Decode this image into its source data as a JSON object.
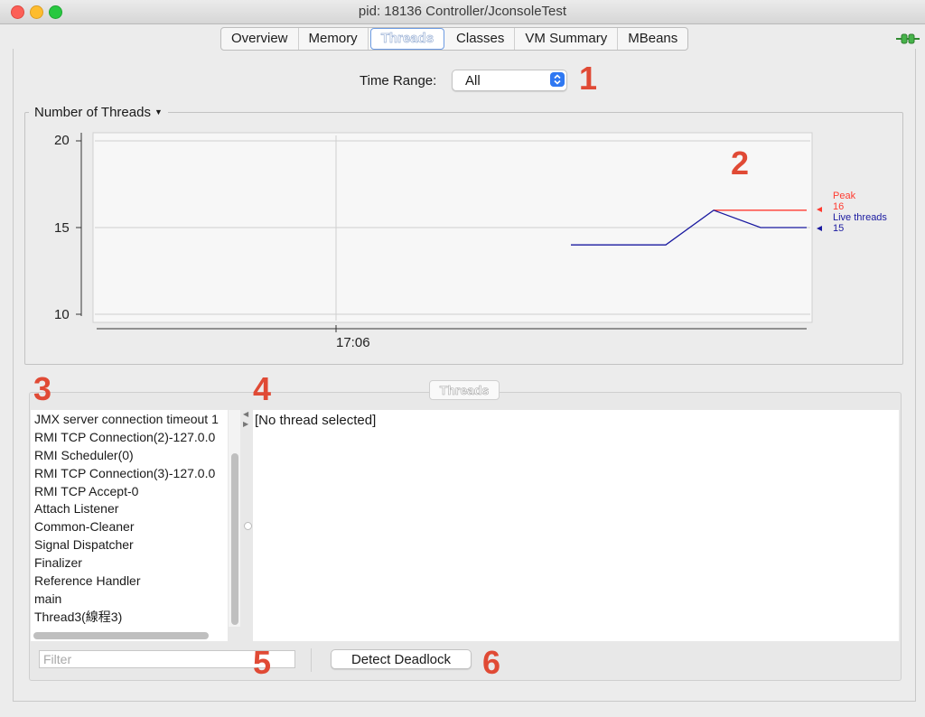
{
  "window": {
    "title": "pid: 18136 Controller/JconsoleTest"
  },
  "tabs": [
    {
      "label": "Overview",
      "active": false
    },
    {
      "label": "Memory",
      "active": false
    },
    {
      "label": "Threads",
      "active": true
    },
    {
      "label": "Classes",
      "active": false
    },
    {
      "label": "VM Summary",
      "active": false
    },
    {
      "label": "MBeans",
      "active": false
    }
  ],
  "time_range": {
    "label": "Time Range:",
    "value": "All"
  },
  "annotations": [
    "1",
    "2",
    "3",
    "4",
    "5",
    "6"
  ],
  "chart_panel": {
    "title": "Number of Threads"
  },
  "chart_data": {
    "type": "line",
    "title": "Number of Threads",
    "xlabel": "",
    "ylabel": "",
    "ylim": [
      10,
      20
    ],
    "y_ticks": [
      "20",
      "15",
      "10"
    ],
    "x_tick_labels": [
      "17:06"
    ],
    "grid": true,
    "legend_position": "right",
    "series": [
      {
        "name": "Peak",
        "color": "#ff3b30",
        "current": "16",
        "values": [
          16,
          16,
          16
        ]
      },
      {
        "name": "Live threads",
        "color": "#1a1aa0",
        "current": "15",
        "values": [
          14,
          14,
          16,
          15,
          15
        ]
      }
    ]
  },
  "threads_section": {
    "label": "Threads"
  },
  "thread_list": [
    "JMX server connection timeout 1",
    "RMI TCP Connection(2)-127.0.0",
    "RMI Scheduler(0)",
    "RMI TCP Connection(3)-127.0.0",
    "RMI TCP Accept-0",
    "Attach Listener",
    "Common-Cleaner",
    "Signal Dispatcher",
    "Finalizer",
    "Reference Handler",
    "main",
    "Thread3(線程3)"
  ],
  "thread_detail": {
    "text": "[No thread selected]"
  },
  "filter": {
    "placeholder": "Filter"
  },
  "deadlock": {
    "label": "Detect Deadlock"
  },
  "colors": {
    "annotation": "#e04a35",
    "peak": "#ff3b30",
    "live": "#1a1aa0"
  }
}
